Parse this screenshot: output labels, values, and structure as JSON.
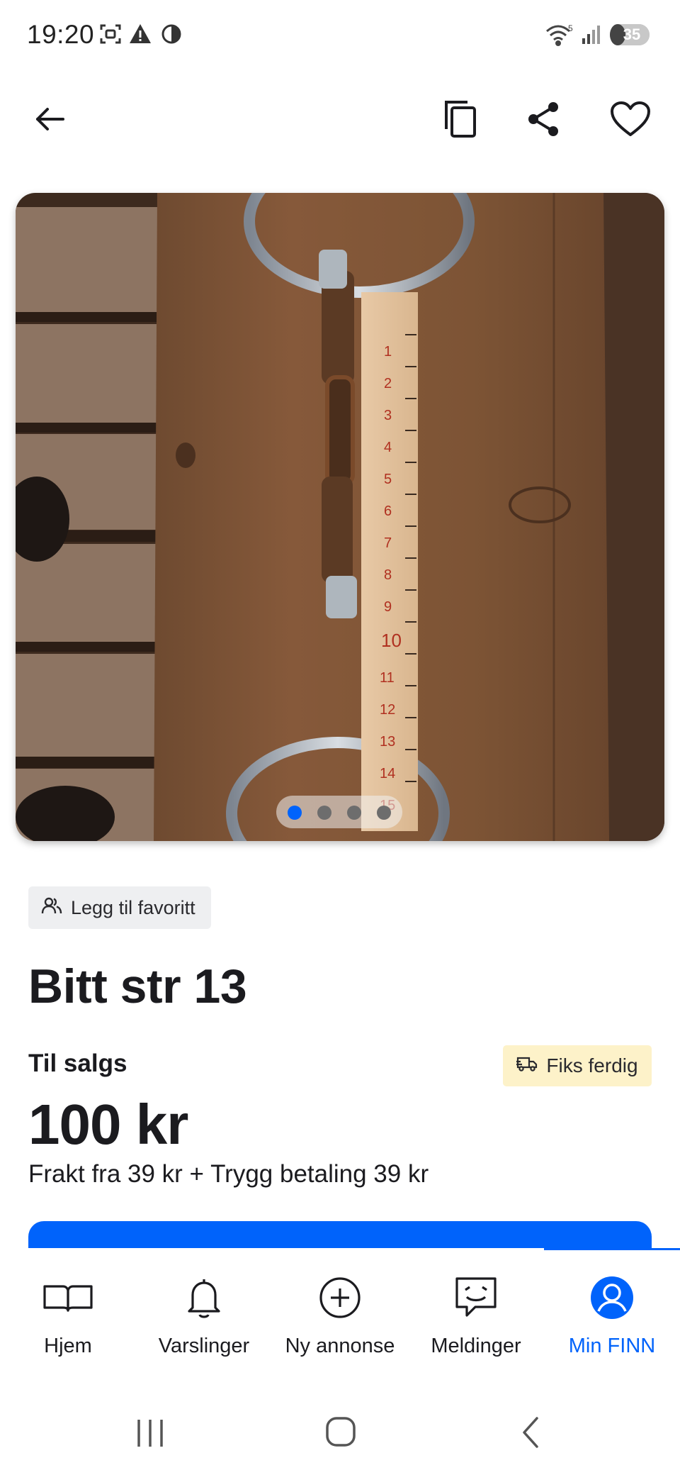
{
  "status_bar": {
    "time": "19:20",
    "battery": "35"
  },
  "top_bar": {
    "back_icon": "arrow-left-icon",
    "copy_icon": "copy-icon",
    "share_icon": "share-icon",
    "favorite_icon": "heart-icon"
  },
  "gallery": {
    "image_count": 4,
    "active_index": 0
  },
  "listing": {
    "favorite_chip": "Legg til favoritt",
    "title": "Bitt str 13",
    "sale_label": "Til salgs",
    "badge": "Fiks ferdig",
    "price": "100 kr",
    "shipping": "Frakt fra 39 kr + Trygg betaling 39 kr"
  },
  "bottom_nav": [
    {
      "label": "Hjem",
      "icon": "book-icon"
    },
    {
      "label": "Varslinger",
      "icon": "bell-icon"
    },
    {
      "label": "Ny annonse",
      "icon": "plus-circle-icon"
    },
    {
      "label": "Meldinger",
      "icon": "chat-icon"
    },
    {
      "label": "Min FINN",
      "icon": "profile-icon",
      "active": true
    }
  ],
  "colors": {
    "accent": "#0063fb",
    "badge_bg": "#fdf2c9",
    "chip_bg": "#eeeff1"
  }
}
